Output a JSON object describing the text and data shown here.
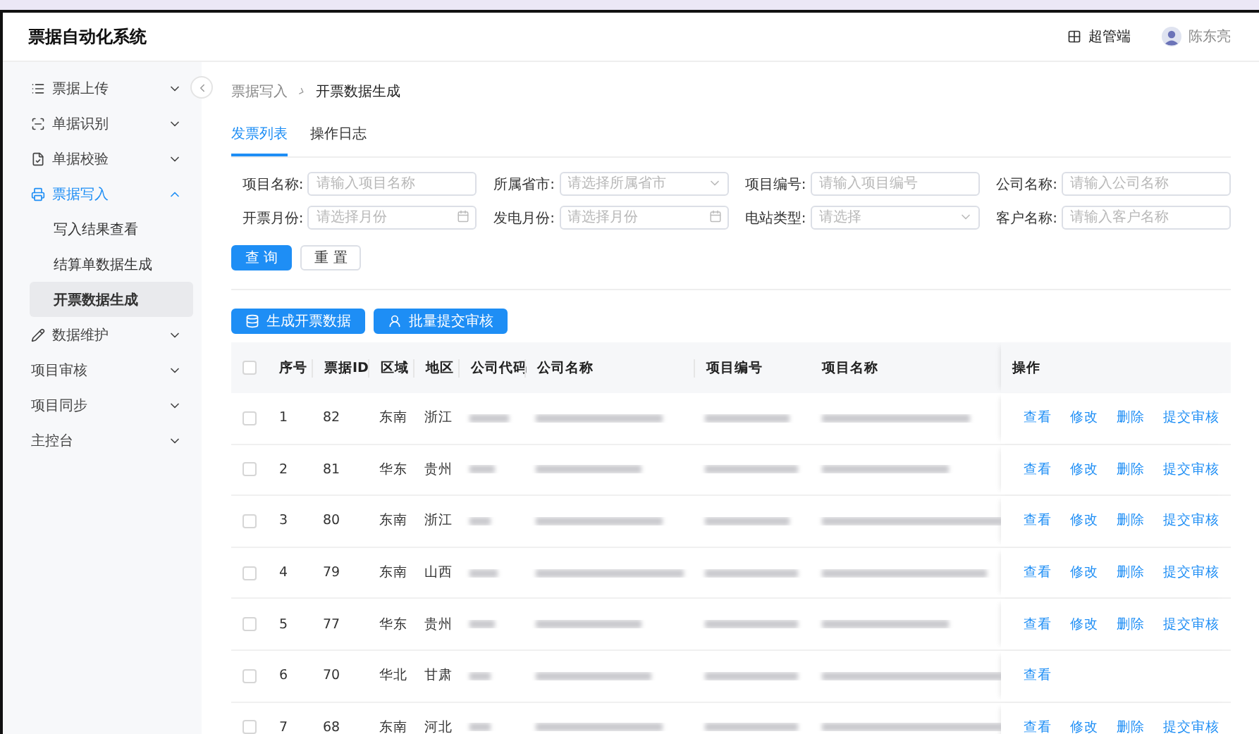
{
  "header": {
    "title": "票据自动化系统",
    "role": "超管端",
    "user": "陈东亮"
  },
  "sidebar": {
    "items": [
      {
        "label": "票据上传",
        "expanded": false
      },
      {
        "label": "单据识别",
        "expanded": false
      },
      {
        "label": "单据校验",
        "expanded": false
      },
      {
        "label": "票据写入",
        "expanded": true,
        "children": [
          {
            "label": "写入结果查看",
            "selected": false
          },
          {
            "label": "结算单数据生成",
            "selected": false
          },
          {
            "label": "开票数据生成",
            "selected": true
          }
        ]
      },
      {
        "label": "数据维护",
        "expanded": false
      },
      {
        "label": "项目审核",
        "expanded": false
      },
      {
        "label": "项目同步",
        "expanded": false
      },
      {
        "label": "主控台",
        "expanded": false
      }
    ]
  },
  "breadcrumb": [
    "票据写入",
    "开票数据生成"
  ],
  "tabs": [
    {
      "label": "发票列表",
      "selected": true
    },
    {
      "label": "操作日志",
      "selected": false
    }
  ],
  "filters": [
    {
      "label": "项目名称:",
      "placeholder": "请输入项目名称",
      "kind": "text"
    },
    {
      "label": "所属省市:",
      "placeholder": "请选择所属省市",
      "kind": "select"
    },
    {
      "label": "项目编号:",
      "placeholder": "请输入项目编号",
      "kind": "text"
    },
    {
      "label": "公司名称:",
      "placeholder": "请输入公司名称",
      "kind": "text"
    },
    {
      "label": "开票月份:",
      "placeholder": "请选择月份",
      "kind": "month"
    },
    {
      "label": "发电月份:",
      "placeholder": "请选择月份",
      "kind": "month"
    },
    {
      "label": "电站类型:",
      "placeholder": "请选择",
      "kind": "select"
    },
    {
      "label": "客户名称:",
      "placeholder": "请输入客户名称",
      "kind": "text"
    }
  ],
  "form_buttons": [
    {
      "label": "查 询",
      "kind": "primary"
    },
    {
      "label": "重 置",
      "kind": "default"
    }
  ],
  "toolbar": [
    {
      "label": "生成开票数据",
      "kind": "generate"
    },
    {
      "label": "批量提交审核",
      "kind": "submit"
    }
  ],
  "table": {
    "header_checked": false,
    "columns": [
      "序号",
      "票据ID",
      "区域",
      "地区",
      "公司代码",
      "公司名称",
      "项目编号",
      "项目名称",
      "操作"
    ],
    "rows": [
      {
        "checked": false,
        "cells": [
          "1",
          "82",
          "东南",
          "浙江"
        ],
        "actions": [
          "查看",
          "修改",
          "删除",
          "提交审核"
        ]
      },
      {
        "checked": false,
        "cells": [
          "2",
          "81",
          "华东",
          "贵州"
        ],
        "actions": [
          "查看",
          "修改",
          "删除",
          "提交审核"
        ]
      },
      {
        "checked": false,
        "cells": [
          "3",
          "80",
          "东南",
          "浙江"
        ],
        "actions": [
          "查看",
          "修改",
          "删除",
          "提交审核"
        ]
      },
      {
        "checked": false,
        "cells": [
          "4",
          "79",
          "东南",
          "山西"
        ],
        "actions": [
          "查看",
          "修改",
          "删除",
          "提交审核"
        ]
      },
      {
        "checked": false,
        "cells": [
          "5",
          "77",
          "华东",
          "贵州"
        ],
        "actions": [
          "查看",
          "修改",
          "删除",
          "提交审核"
        ]
      },
      {
        "checked": false,
        "cells": [
          "6",
          "70",
          "华北",
          "甘肃"
        ],
        "actions": [
          "查看"
        ]
      },
      {
        "checked": false,
        "cells": [
          "7",
          "68",
          "东南",
          "河北"
        ],
        "actions": [
          "查看",
          "修改",
          "删除",
          "提交审核"
        ]
      }
    ]
  }
}
